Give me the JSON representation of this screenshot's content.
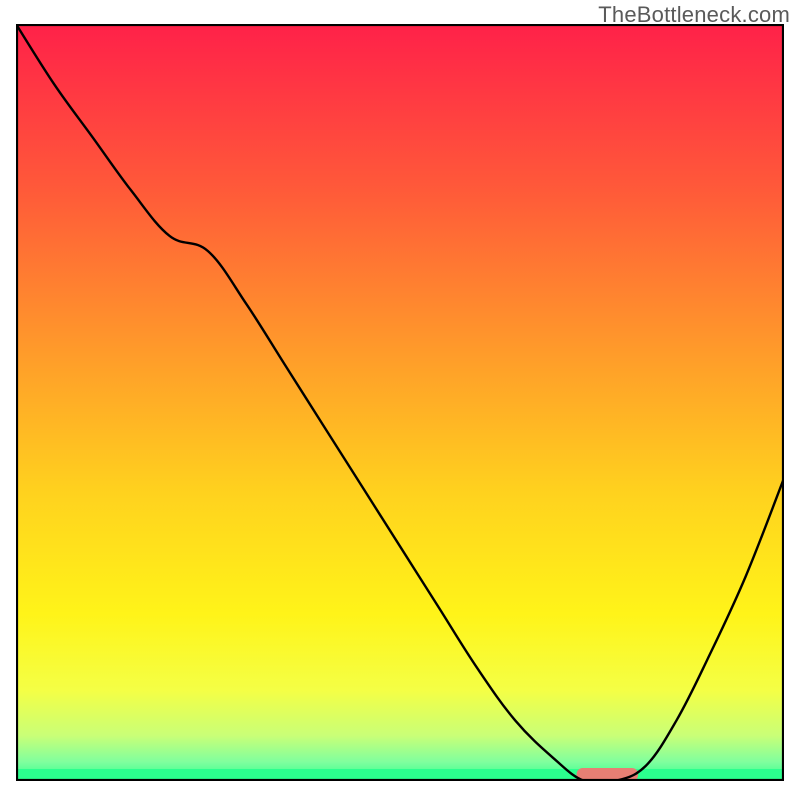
{
  "watermark": "TheBottleneck.com",
  "chart_data": {
    "type": "line",
    "title": "",
    "xlabel": "",
    "ylabel": "",
    "xlim": [
      0,
      100
    ],
    "ylim": [
      0,
      100
    ],
    "x": [
      0,
      5,
      10,
      15,
      20,
      25,
      30,
      35,
      40,
      45,
      50,
      55,
      60,
      65,
      70,
      74,
      78,
      82,
      86,
      90,
      95,
      100
    ],
    "values": [
      100,
      92,
      85,
      78,
      72,
      70,
      63,
      55,
      47,
      39,
      31,
      23,
      15,
      8,
      3,
      0,
      0,
      2,
      8,
      16,
      27,
      40
    ],
    "optimal_range_x": [
      73,
      81
    ],
    "gradient_stops": [
      {
        "offset": 0.0,
        "color": "#ff2149"
      },
      {
        "offset": 0.22,
        "color": "#ff5a39"
      },
      {
        "offset": 0.45,
        "color": "#ffa029"
      },
      {
        "offset": 0.62,
        "color": "#ffd21e"
      },
      {
        "offset": 0.78,
        "color": "#fff419"
      },
      {
        "offset": 0.88,
        "color": "#f4ff45"
      },
      {
        "offset": 0.94,
        "color": "#c9ff77"
      },
      {
        "offset": 0.975,
        "color": "#7fff9e"
      },
      {
        "offset": 1.0,
        "color": "#2bff8e"
      }
    ],
    "marker_color": "#e77f74",
    "curve_color": "#000000"
  }
}
